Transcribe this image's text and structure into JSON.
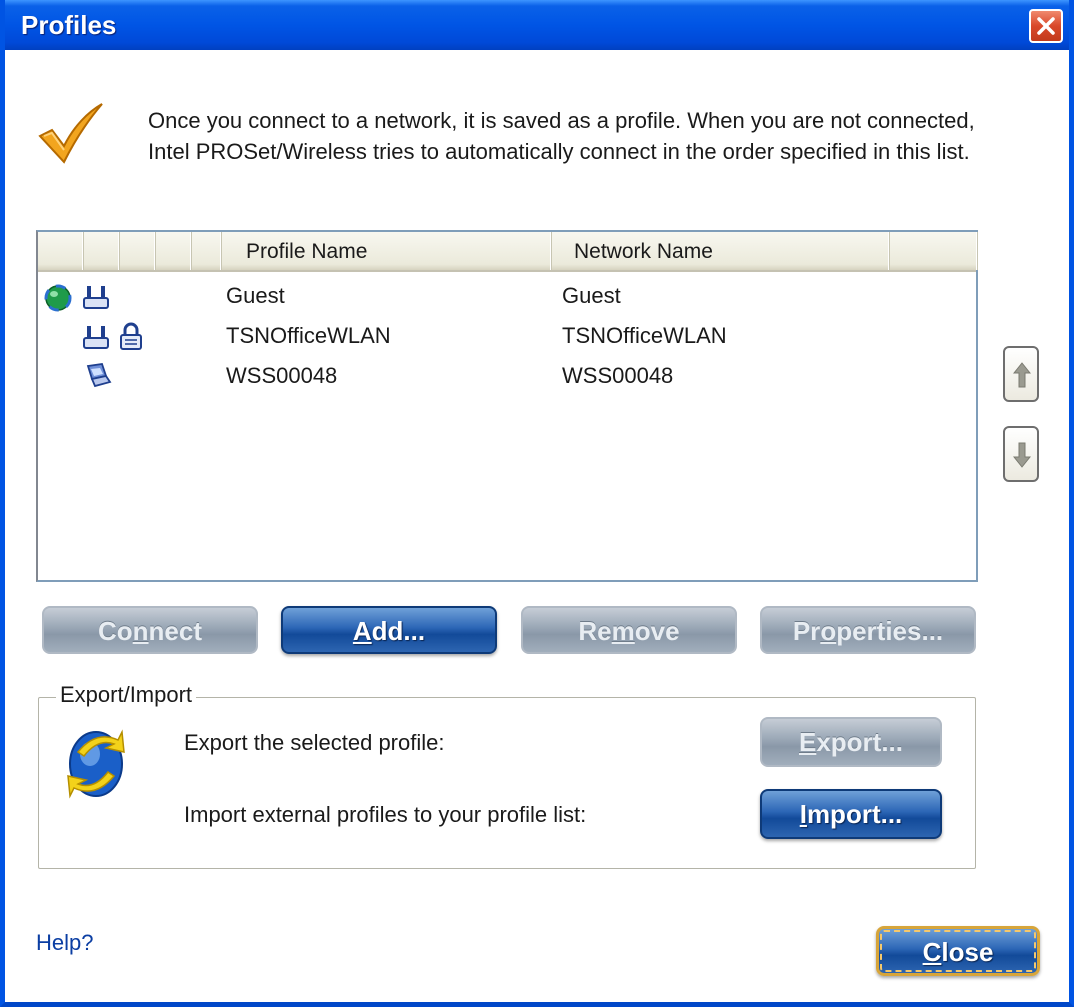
{
  "window": {
    "title": "Profiles"
  },
  "intro": {
    "text": "Once you connect to a network, it is saved as a profile. When you are not connected, Intel PROSet/Wireless tries to automatically connect in the order specified in this list."
  },
  "list": {
    "columns": [
      "Profile Name",
      "Network Name"
    ],
    "rows": [
      {
        "profile": "Guest",
        "network": "Guest",
        "icons": [
          "connected-globe-icon",
          "infrastructure-network-icon"
        ]
      },
      {
        "profile": "TSNOfficeWLAN",
        "network": "TSNOfficeWLAN",
        "icons": [
          "infrastructure-network-icon",
          "security-lock-icon"
        ]
      },
      {
        "profile": "WSS00048",
        "network": "WSS00048",
        "icons": [
          "adhoc-laptop-icon"
        ]
      }
    ]
  },
  "buttons": {
    "connect": {
      "pre": "Co",
      "key": "n",
      "post": "nect"
    },
    "add": {
      "pre": "",
      "key": "A",
      "post": "dd..."
    },
    "remove": {
      "pre": "Re",
      "key": "m",
      "post": "ove"
    },
    "properties": {
      "pre": "Pr",
      "key": "o",
      "post": "perties..."
    },
    "close": {
      "pre": "",
      "key": "C",
      "post": "lose"
    }
  },
  "export_import": {
    "label": "Export/Import",
    "export_text": "Export the selected profile:",
    "import_text": "Import external profiles to your profile list:",
    "export_button": {
      "pre": "",
      "key": "E",
      "post": "xport..."
    },
    "import_button": {
      "pre": "",
      "key": "I",
      "post": "mport..."
    }
  },
  "help": {
    "label": "Help?"
  },
  "colors": {
    "titlebar": "#0055e5",
    "primary_button": "#124a99",
    "disabled_button": "#9eabb9",
    "link": "#0b3ea3"
  }
}
